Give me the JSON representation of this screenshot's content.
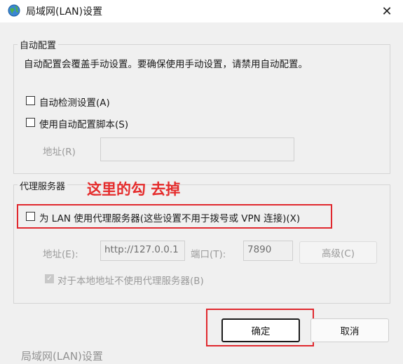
{
  "window": {
    "title": "局域网(LAN)设置",
    "close_glyph": "✕"
  },
  "auto_config": {
    "group_label": "自动配置",
    "description": "自动配置会覆盖手动设置。要确保使用手动设置，请禁用自动配置。",
    "auto_detect_label": "自动检测设置(A)",
    "auto_detect_checked": false,
    "use_script_label": "使用自动配置脚本(S)",
    "use_script_checked": false,
    "address_label": "地址(R)",
    "address_value": ""
  },
  "proxy": {
    "group_label": "代理服务器",
    "use_proxy_label": "为 LAN 使用代理服务器(这些设置不用于拨号或 VPN 连接)(X)",
    "use_proxy_checked": false,
    "address_label": "地址(E):",
    "address_value": "http://127.0.0.1",
    "port_label": "端口(T):",
    "port_value": "7890",
    "advanced_label": "高级(C)",
    "bypass_local_label": "对于本地地址不使用代理服务器(B)",
    "bypass_local_checked": true
  },
  "annotation": {
    "text": "这里的勾 去掉",
    "color": "#e52c2c"
  },
  "buttons": {
    "ok_label": "确定",
    "cancel_label": "取消"
  },
  "background_text": "局域网(LAN)设置",
  "icons": {
    "app": "globe-network-icon",
    "close": "close-icon",
    "check": "checkmark-icon"
  }
}
